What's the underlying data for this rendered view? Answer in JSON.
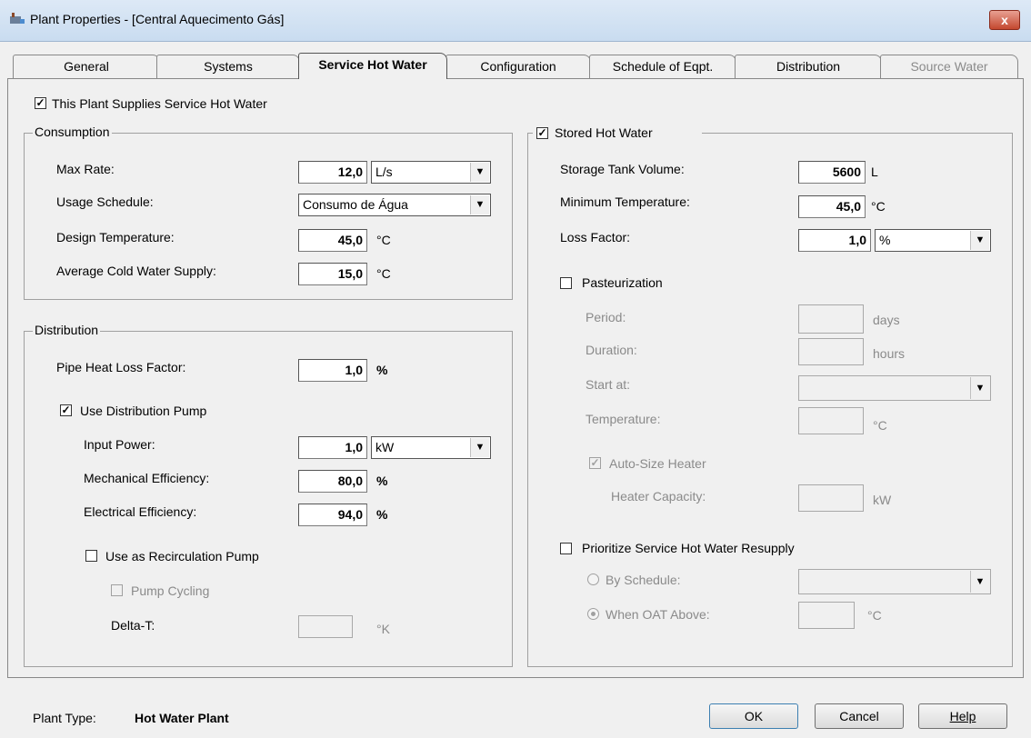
{
  "window": {
    "title": "Plant Properties - [Central Aquecimento Gás]",
    "close_label": "x"
  },
  "tabs": [
    {
      "label": "General"
    },
    {
      "label": "Systems"
    },
    {
      "label": "Service Hot Water"
    },
    {
      "label": "Configuration"
    },
    {
      "label": "Schedule of Eqpt."
    },
    {
      "label": "Distribution"
    },
    {
      "label": "Source Water"
    }
  ],
  "supplies_shw": {
    "label": "This Plant Supplies Service Hot Water",
    "checked": true
  },
  "consumption": {
    "legend": "Consumption",
    "max_rate": {
      "label": "Max Rate:",
      "value": "12,0",
      "unit": "L/s"
    },
    "usage_schedule": {
      "label": "Usage Schedule:",
      "value": "Consumo de Água"
    },
    "design_temp": {
      "label": "Design Temperature:",
      "value": "45,0",
      "unit": "°C"
    },
    "avg_cold": {
      "label": "Average Cold Water Supply:",
      "value": "15,0",
      "unit": "°C"
    }
  },
  "distribution": {
    "legend": "Distribution",
    "pipe_loss": {
      "label": "Pipe Heat Loss Factor:",
      "value": "1,0",
      "unit": "%"
    },
    "use_pump": {
      "label": "Use Distribution Pump",
      "checked": true
    },
    "input_power": {
      "label": "Input Power:",
      "value": "1,0",
      "unit": "kW"
    },
    "mech_eff": {
      "label": "Mechanical Efficiency:",
      "value": "80,0",
      "unit": "%"
    },
    "elec_eff": {
      "label": "Electrical Efficiency:",
      "value": "94,0",
      "unit": "%"
    },
    "recirc": {
      "label": "Use as Recirculation Pump",
      "checked": false
    },
    "pump_cycling": {
      "label": "Pump Cycling",
      "checked": false
    },
    "delta_t": {
      "label": "Delta-T:",
      "value": "",
      "unit": "°K"
    }
  },
  "stored": {
    "legend": "Stored Hot Water",
    "checked": true,
    "tank_volume": {
      "label": "Storage Tank Volume:",
      "value": "5600",
      "unit": "L"
    },
    "min_temp": {
      "label": "Minimum Temperature:",
      "value": "45,0",
      "unit": "°C"
    },
    "loss_factor": {
      "label": "Loss Factor:",
      "value": "1,0",
      "unit": "%"
    },
    "pasteurization": {
      "label": "Pasteurization",
      "checked": false
    },
    "period": {
      "label": "Period:",
      "value": "",
      "unit": "days"
    },
    "duration": {
      "label": "Duration:",
      "value": "",
      "unit": "hours"
    },
    "start_at": {
      "label": "Start at:",
      "value": ""
    },
    "temperature": {
      "label": "Temperature:",
      "value": "",
      "unit": "°C"
    },
    "auto_size": {
      "label": "Auto-Size Heater",
      "checked": true
    },
    "heater_capacity": {
      "label": "Heater Capacity:",
      "value": "",
      "unit": "kW"
    },
    "prioritize": {
      "label": "Prioritize Service Hot Water Resupply",
      "checked": false
    },
    "by_schedule": {
      "label": "By Schedule:",
      "value": ""
    },
    "when_oat": {
      "label": "When OAT Above:",
      "value": "",
      "unit": "°C"
    }
  },
  "footer": {
    "plant_type_label": "Plant Type:",
    "plant_type_value": "Hot Water Plant",
    "ok": "OK",
    "cancel": "Cancel",
    "help": "Help"
  }
}
